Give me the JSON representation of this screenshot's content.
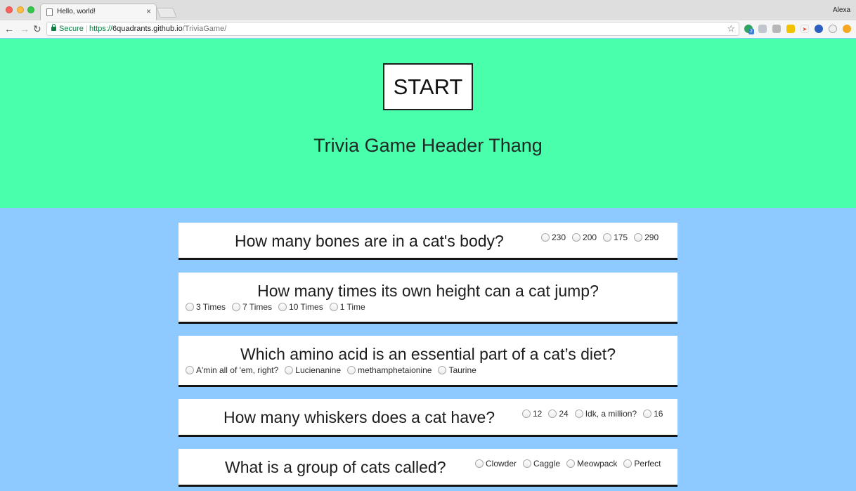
{
  "browser": {
    "tab_title": "Hello, world!",
    "tab_close": "×",
    "profile_name": "Alexa",
    "secure_label": "Secure",
    "url_scheme": "https://",
    "url_host": "6quadrants.github.io",
    "url_path": "/TriviaGame/",
    "extension_badge": "2"
  },
  "hero": {
    "start_label": "START",
    "title": "Trivia Game Header Thang",
    "background": "#4affab"
  },
  "page_background": "#8ecaff",
  "questions": [
    {
      "text": "How many bones are in a cat's body?",
      "options": [
        "230",
        "200",
        "175",
        "290"
      ]
    },
    {
      "text": "How many times its own height can a cat jump?",
      "options": [
        "3 Times",
        "7 Times",
        "10 Times",
        "1 Time"
      ]
    },
    {
      "text": "Which amino acid is an essential part of a cat’s diet?",
      "options": [
        "A'min all of 'em, right?",
        "Lucienanine",
        "methamphetaionine",
        "Taurine"
      ]
    },
    {
      "text": "How many whiskers does a cat have?",
      "options": [
        "12",
        "24",
        "Idk, a million?",
        "16"
      ]
    },
    {
      "text": "What is a group of cats called?",
      "options": [
        "Clowder",
        "Caggle",
        "Meowpack",
        "Perfect"
      ]
    }
  ]
}
